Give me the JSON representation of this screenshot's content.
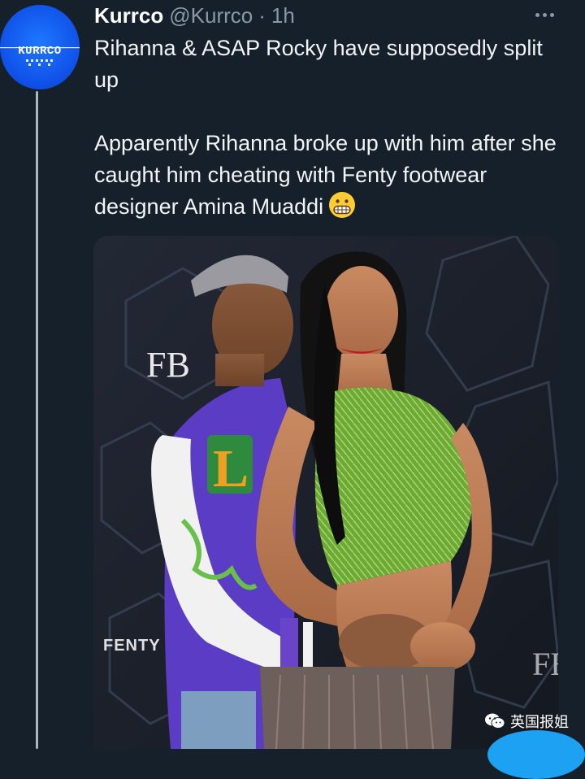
{
  "tweet": {
    "display_name": "Kurrco",
    "handle": "@Kurrco",
    "separator": "·",
    "time": "1h",
    "text_line_1": "Rihanna & ASAP Rocky have supposedly split up",
    "text_line_2": "Apparently Rihanna broke up with him after she caught him cheating with Fenty footwear designer Amina Muaddi",
    "emoji_name": "grimacing-face-emoji",
    "avatar_logo": "KURRCO"
  },
  "media": {
    "brand_logo": "FB",
    "signage_text": "FENTY",
    "signage_small": "FE",
    "jacket_letter": "L"
  },
  "overlay": {
    "watermark_text": "英国报姐",
    "watermark_icon": "wechat-icon"
  },
  "colors": {
    "background": "#15202b",
    "secondary_text": "#8b98a5",
    "accent_blue": "#1da1f2"
  }
}
